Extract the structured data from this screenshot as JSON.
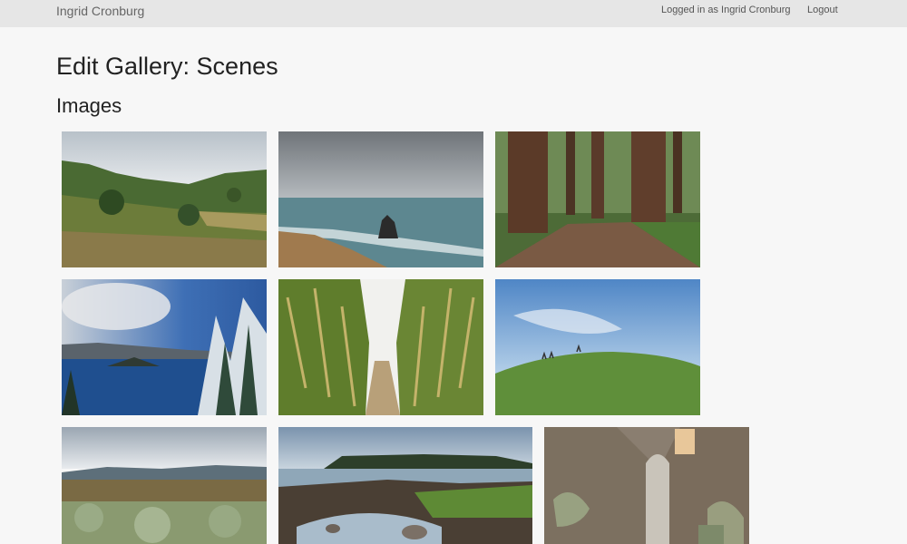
{
  "navbar": {
    "brand": "Ingrid Cronburg",
    "logged_in_text": "Logged in as Ingrid Cronburg",
    "logout_label": "Logout",
    "background": "#e6e6e6"
  },
  "page": {
    "title": "Edit Gallery: Scenes",
    "section_title": "Images"
  },
  "gallery": {
    "images": [
      {
        "subject": "green hills with trees and dry grass under cloudy sky"
      },
      {
        "subject": "ocean with sea stack rock under stormy clouds"
      },
      {
        "subject": "redwood forest with tall trunks and dirt path"
      },
      {
        "subject": "crater lake with island and snowy pine trees"
      },
      {
        "subject": "path through tall cornfield"
      },
      {
        "subject": "grassy hill with people under blue sky"
      },
      {
        "subject": "desert sagebrush valley with distant hills"
      },
      {
        "subject": "rocky shoreline tide pool with forested island"
      },
      {
        "subject": "ruined prison cell corridor with skylight"
      }
    ]
  }
}
